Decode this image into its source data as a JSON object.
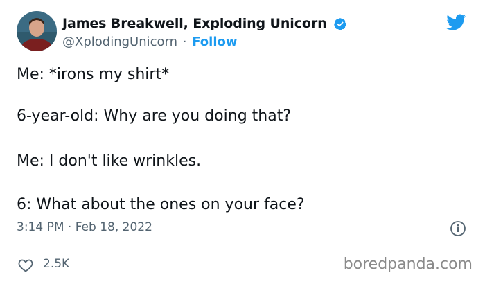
{
  "author": {
    "name": "James Breakwell, Exploding Unicorn",
    "handle": "@XplodingUnicorn",
    "separator": "·",
    "follow_label": "Follow",
    "verified_icon": "verified-badge-icon"
  },
  "tweet": {
    "lines": [
      "Me: *irons my shirt*",
      "6-year-old: Why are you doing that?",
      "Me: I don't like wrinkles.",
      "6: What about the ones on your face?"
    ],
    "timestamp": "3:14 PM · Feb 18, 2022",
    "likes": "2.5K"
  },
  "watermark": "boredpanda.com",
  "colors": {
    "accent": "#1d9bf0",
    "muted": "#536471",
    "text": "#0f1419"
  }
}
